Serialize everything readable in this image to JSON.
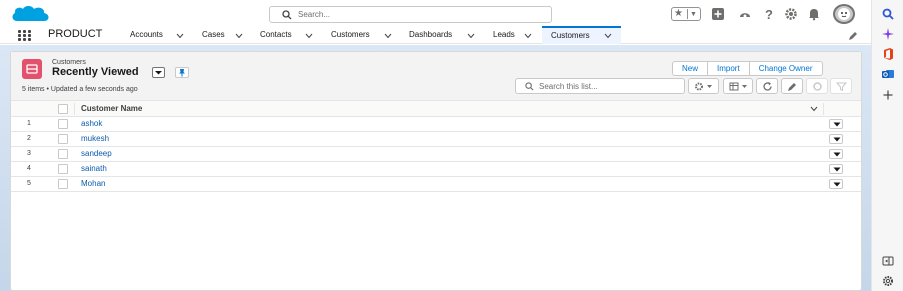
{
  "header": {
    "search_placeholder": "Search...",
    "brand_color": "#00a1e0"
  },
  "nav": {
    "app_name": "PRODUCT",
    "items": [
      {
        "label": "Accounts"
      },
      {
        "label": "Cases"
      },
      {
        "label": "Contacts"
      },
      {
        "label": "Customers"
      },
      {
        "label": "Dashboards"
      },
      {
        "label": "Leads"
      },
      {
        "label": "Customers",
        "active": true
      }
    ]
  },
  "list": {
    "object_label": "Customers",
    "view_name": "Recently Viewed",
    "meta": "5 items • Updated a few seconds ago",
    "actions": {
      "new": "New",
      "import": "Import",
      "change_owner": "Change Owner"
    },
    "search_placeholder": "Search this list...",
    "column_header": "Customer Name",
    "rows": [
      {
        "num": "1",
        "name": "ashok"
      },
      {
        "num": "2",
        "name": "mukesh"
      },
      {
        "num": "3",
        "name": "sandeep"
      },
      {
        "num": "4",
        "name": "sainath"
      },
      {
        "num": "5",
        "name": "Mohan"
      }
    ]
  },
  "colors": {
    "accent": "#0176d3",
    "link": "#0b5cab",
    "object_icon": "#e3526c"
  }
}
